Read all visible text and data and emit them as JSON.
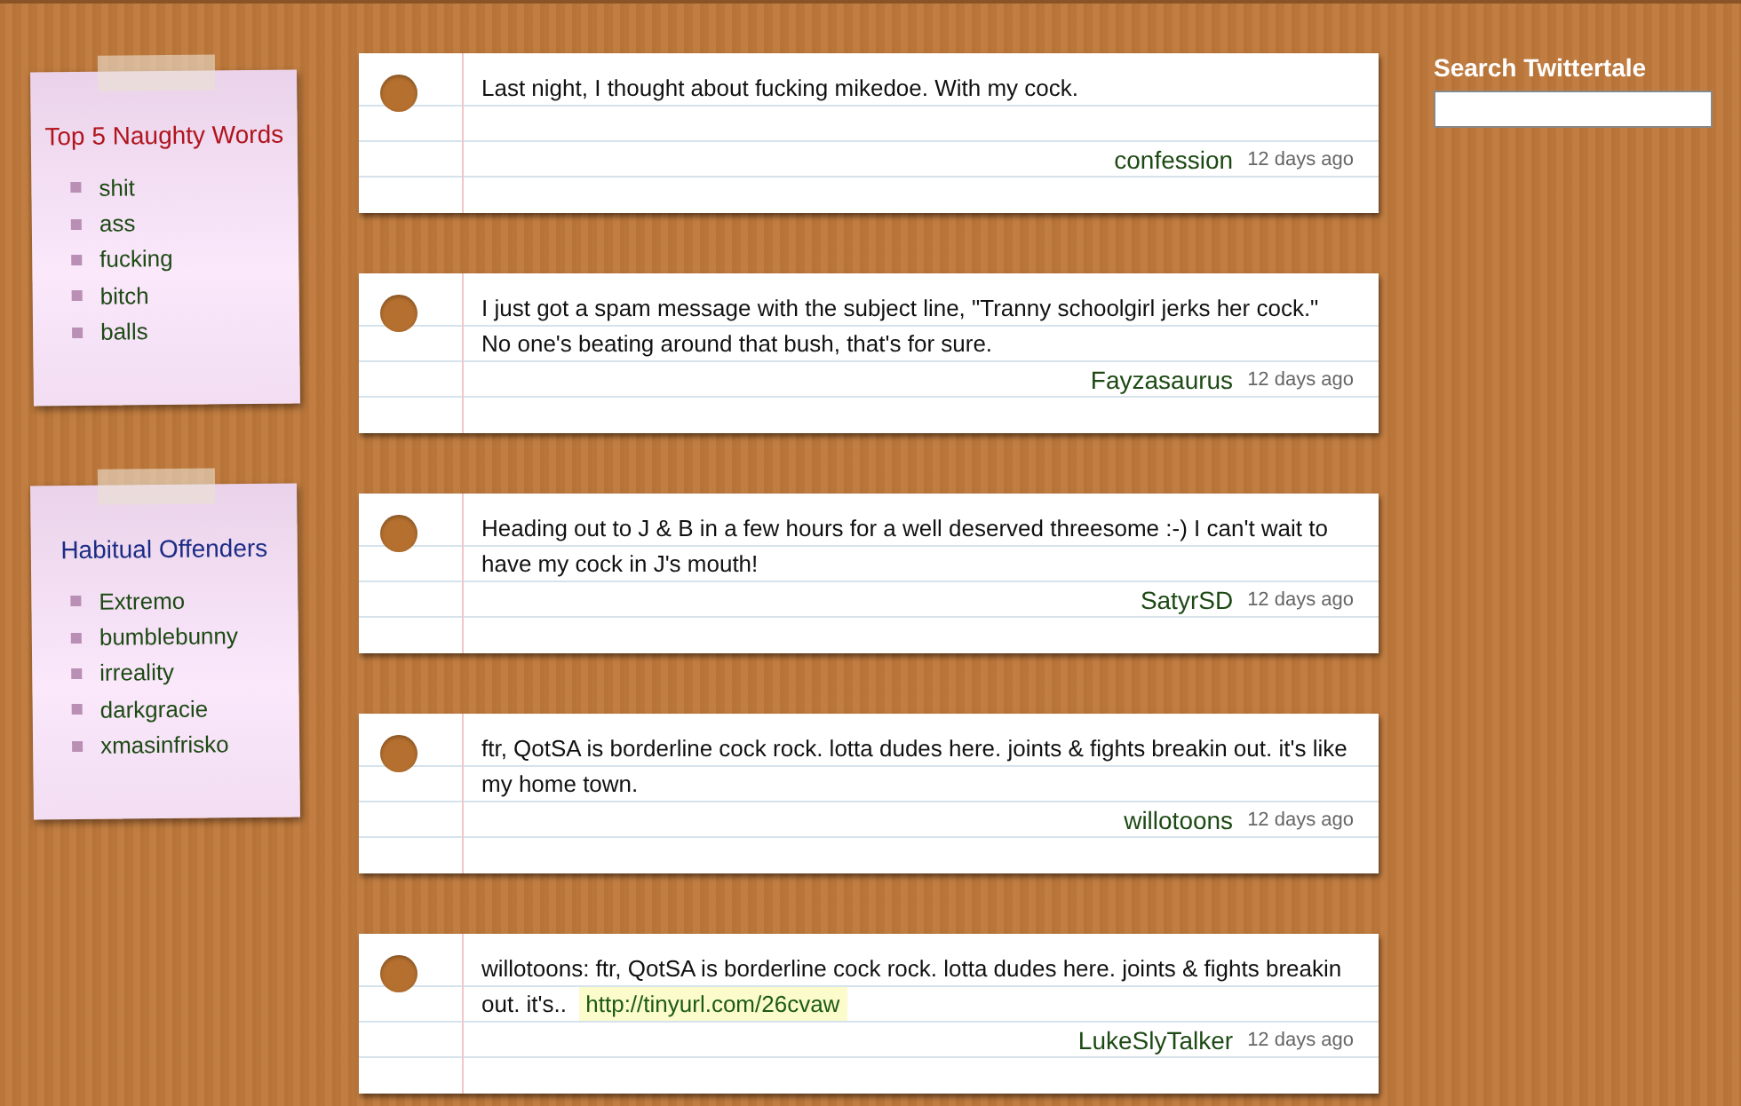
{
  "notes": [
    {
      "title": "Top 5 Naughty Words",
      "kind": "words",
      "items": [
        "shit",
        "ass",
        "fucking",
        "bitch",
        "balls"
      ]
    },
    {
      "title": "Habitual Offenders",
      "kind": "users",
      "items": [
        "Extremo",
        "bumblebunny",
        "irreality",
        "darkgracie",
        "xmasinfrisko"
      ]
    }
  ],
  "tweets": [
    {
      "text": "Last night, I thought about fucking mikedoe. With my cock.",
      "author": "confession",
      "time": "12 days ago"
    },
    {
      "text": "I just got a spam message with the subject line, \"Tranny schoolgirl jerks her cock.\" No one's beating around that bush, that's for sure.",
      "author": "Fayzasaurus",
      "time": "12 days ago"
    },
    {
      "text": "Heading out to J & B in a few hours for a well deserved threesome :-) I can't wait to have my cock in J's mouth!",
      "author": "SatyrSD",
      "time": "12 days ago"
    },
    {
      "text": "ftr, QotSA is borderline cock rock. lotta dudes here. joints & fights breakin out. it's like my home town.",
      "author": "willotoons",
      "time": "12 days ago"
    },
    {
      "text": "willotoons: ftr, QotSA is borderline cock rock. lotta dudes here. joints & fights breakin out. it's..",
      "link": "http://tinyurl.com/26cvaw",
      "author": "LukeSlyTalker",
      "time": "12 days ago"
    }
  ],
  "search": {
    "label": "Search Twittertale"
  }
}
